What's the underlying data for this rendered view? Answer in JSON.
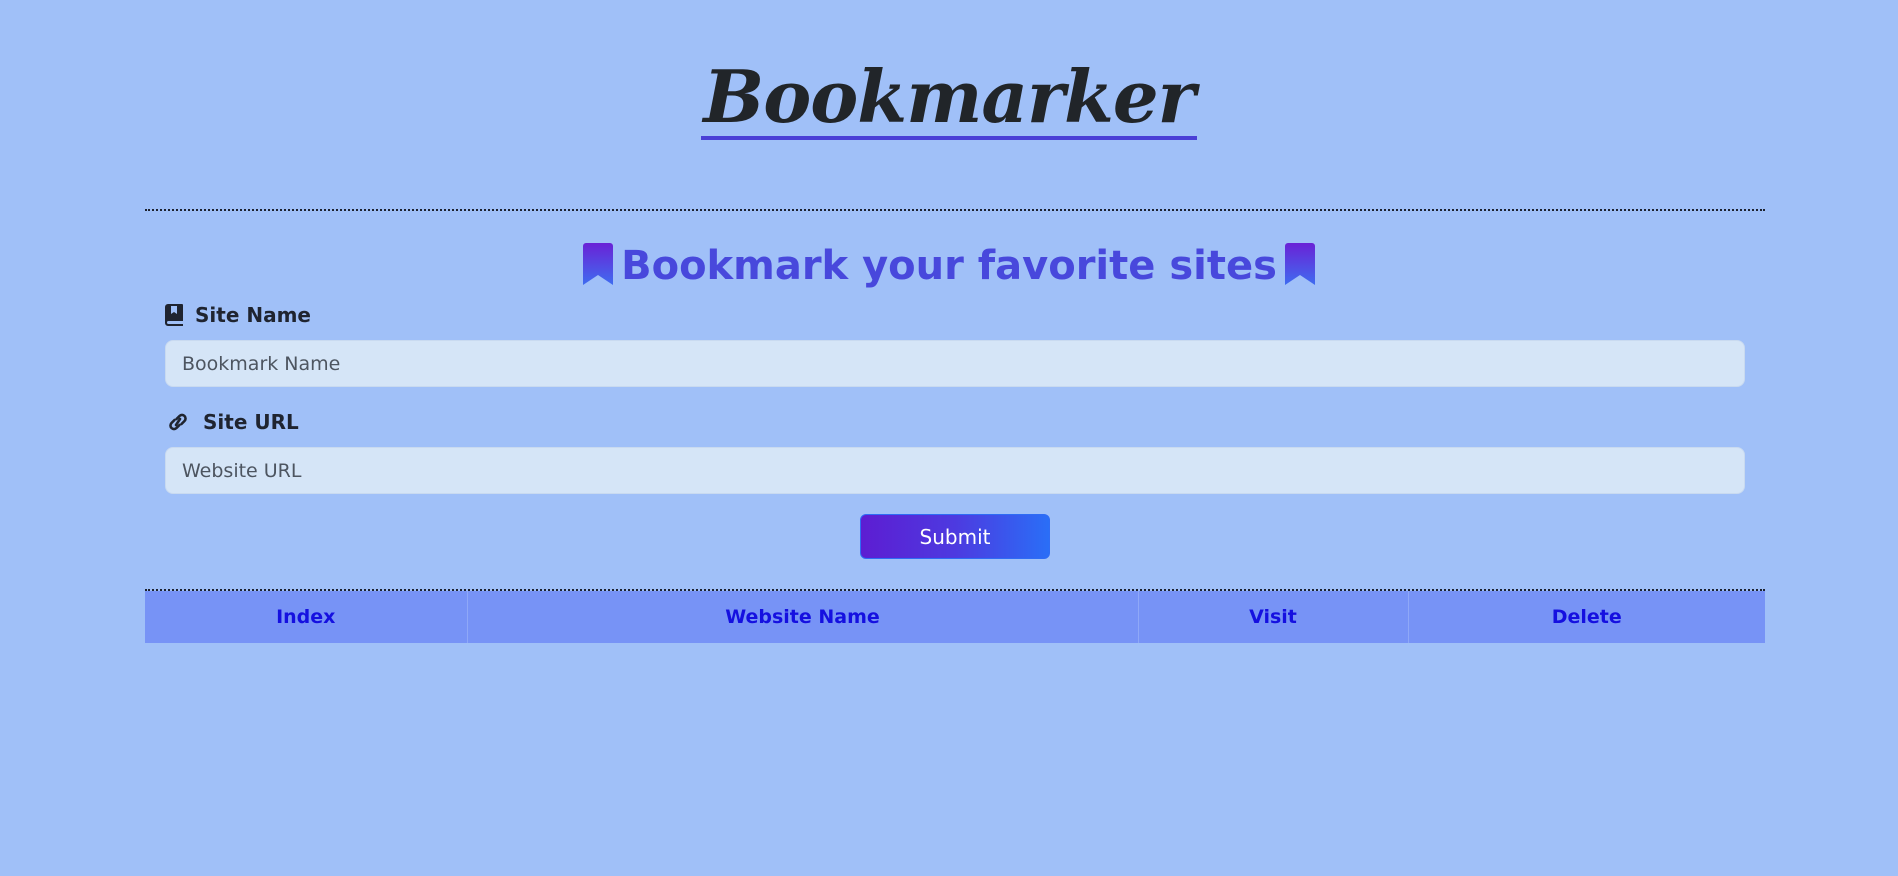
{
  "header": {
    "title": "Bookmarker"
  },
  "form": {
    "heading": "Bookmark your favorite sites",
    "site_name_label": "Site Name",
    "site_name_placeholder": "Bookmark Name",
    "site_name_value": "",
    "site_url_label": "Site URL",
    "site_url_placeholder": "Website URL",
    "site_url_value": "",
    "submit_label": "Submit"
  },
  "table": {
    "columns": [
      "Index",
      "Website Name",
      "Visit",
      "Delete"
    ],
    "rows": []
  },
  "icons": {
    "heading_left": "bookmark-icon",
    "heading_right": "bookmark-icon",
    "site_name": "book-bookmark-icon",
    "site_url": "link-icon"
  },
  "colors": {
    "background": "#a0c0f8",
    "accent": "#4848dc",
    "title_underline": "#4a3fd6",
    "button_gradient_start": "#5d1dd2",
    "button_gradient_end": "#2a6ef7",
    "table_header_bg": "#7793f6",
    "table_header_text": "#1510e0",
    "input_bg": "#d5e5f7"
  }
}
